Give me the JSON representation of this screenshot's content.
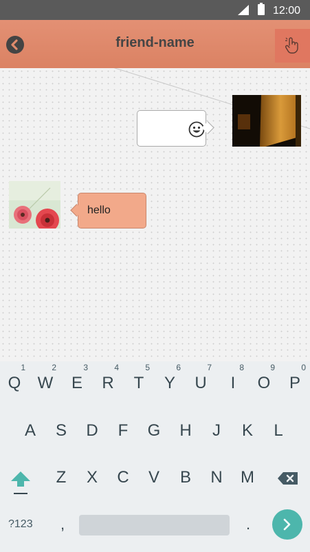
{
  "status_bar": {
    "time": "12:00"
  },
  "header": {
    "title": "friend-name"
  },
  "chat": {
    "messages": [
      {
        "side": "right",
        "type": "emoji",
        "icon": "smiley-face-icon"
      },
      {
        "side": "left",
        "type": "text",
        "text": "hello"
      }
    ]
  },
  "keyboard": {
    "row1": [
      {
        "label": "Q",
        "hint": "1"
      },
      {
        "label": "W",
        "hint": "2"
      },
      {
        "label": "E",
        "hint": "3"
      },
      {
        "label": "R",
        "hint": "4"
      },
      {
        "label": "T",
        "hint": "5"
      },
      {
        "label": "Y",
        "hint": "6"
      },
      {
        "label": "U",
        "hint": "7"
      },
      {
        "label": "I",
        "hint": "8"
      },
      {
        "label": "O",
        "hint": "9"
      },
      {
        "label": "P",
        "hint": "0"
      }
    ],
    "row2": [
      "A",
      "S",
      "D",
      "F",
      "G",
      "H",
      "J",
      "K",
      "L"
    ],
    "row3": [
      "Z",
      "X",
      "C",
      "V",
      "B",
      "N",
      "M"
    ],
    "symbols_label": "?123",
    "comma_label": ",",
    "period_label": ".",
    "accent_color": "#4db6ac"
  },
  "colors": {
    "header": "#df8a6b",
    "incoming_bubble": "#f2a98a",
    "status_bar": "#5a5a5a"
  }
}
